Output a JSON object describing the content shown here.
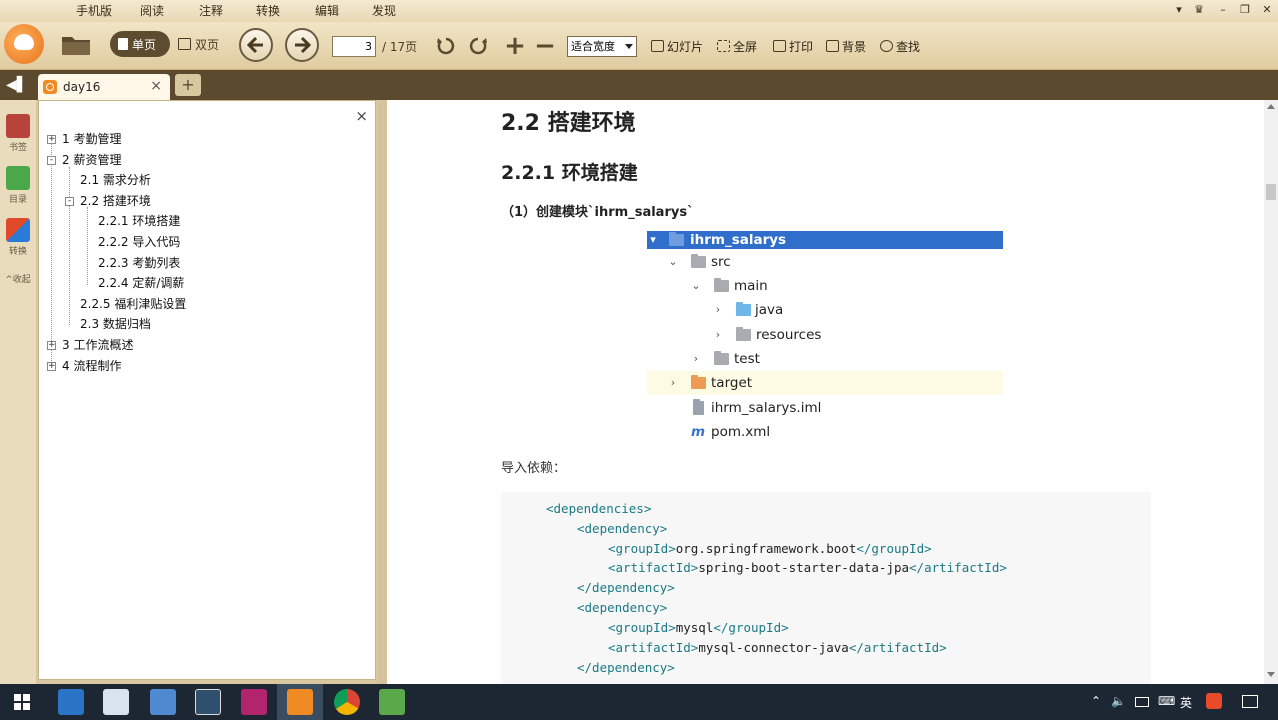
{
  "menu": {
    "items": [
      "手机版",
      "阅读",
      "注释",
      "转换",
      "编辑",
      "发现"
    ]
  },
  "toolbar": {
    "single_page": "单页",
    "double_page": "双页",
    "page_current": "3",
    "page_total": "/ 17页",
    "zoom": "适合宽度",
    "slideshow": "幻灯片",
    "fullscreen": "全屏",
    "print": "打印",
    "background": "背景",
    "find": "查找"
  },
  "tabs": {
    "active": "day16",
    "new_tab": "+"
  },
  "sidebar": {
    "bookmarks": "书签",
    "toc": "目录",
    "convert": "转换",
    "collapse": "^收起"
  },
  "outline": {
    "items": [
      {
        "label": "1 考勤管理",
        "expander": "+"
      },
      {
        "label": "2 薪资管理",
        "expander": "-"
      },
      {
        "label": "2.1 需求分析",
        "expander": ""
      },
      {
        "label": "2.2 搭建环境",
        "expander": "-"
      },
      {
        "label": "2.2.1 环境搭建",
        "expander": ""
      },
      {
        "label": "2.2.2 导入代码",
        "expander": ""
      },
      {
        "label": "2.2.3 考勤列表",
        "expander": ""
      },
      {
        "label": "2.2.4 定薪/调薪",
        "expander": ""
      },
      {
        "label": "2.2.5 福利津贴设置",
        "expander": ""
      },
      {
        "label": "2.3 数据归档",
        "expander": ""
      },
      {
        "label": "3 工作流概述",
        "expander": "+"
      },
      {
        "label": "4 流程制作",
        "expander": "+"
      }
    ]
  },
  "document": {
    "h2": "2.2 搭建环境",
    "h3": "2.2.1 环境搭建",
    "h4": "（1）创建模块`ihrm_salarys`",
    "project_tree": [
      {
        "label": "ihrm_salarys",
        "arrow": "▾"
      },
      {
        "label": "src",
        "arrow": "⌄"
      },
      {
        "label": "main",
        "arrow": "⌄"
      },
      {
        "label": "java",
        "arrow": "›"
      },
      {
        "label": "resources",
        "arrow": "›"
      },
      {
        "label": "test",
        "arrow": "›"
      },
      {
        "label": "target",
        "arrow": "›"
      },
      {
        "label": "ihrm_salarys.iml",
        "arrow": ""
      },
      {
        "label": "pom.xml",
        "arrow": ""
      }
    ],
    "import_text": "导入依赖：",
    "code": [
      {
        "open": "<dependencies>",
        "text": "",
        "close": ""
      },
      {
        "open": "<dependency>",
        "text": "",
        "close": ""
      },
      {
        "open": "<groupId>",
        "text": "org.springframework.boot",
        "close": "</groupId>"
      },
      {
        "open": "<artifactId>",
        "text": "spring-boot-starter-data-jpa",
        "close": "</artifactId>"
      },
      {
        "open": "</dependency>",
        "text": "",
        "close": ""
      },
      {
        "open": "<dependency>",
        "text": "",
        "close": ""
      },
      {
        "open": "<groupId>",
        "text": "mysql",
        "close": "</groupId>"
      },
      {
        "open": "<artifactId>",
        "text": "mysql-connector-java",
        "close": "</artifactId>"
      },
      {
        "open": "</dependency>",
        "text": "",
        "close": ""
      }
    ]
  },
  "tray": {
    "ime": "英"
  },
  "colors": {
    "selection": "#2f6ecb",
    "xml_tag": "#1a7a86",
    "toolbar_bg": "#e8d8b4"
  }
}
